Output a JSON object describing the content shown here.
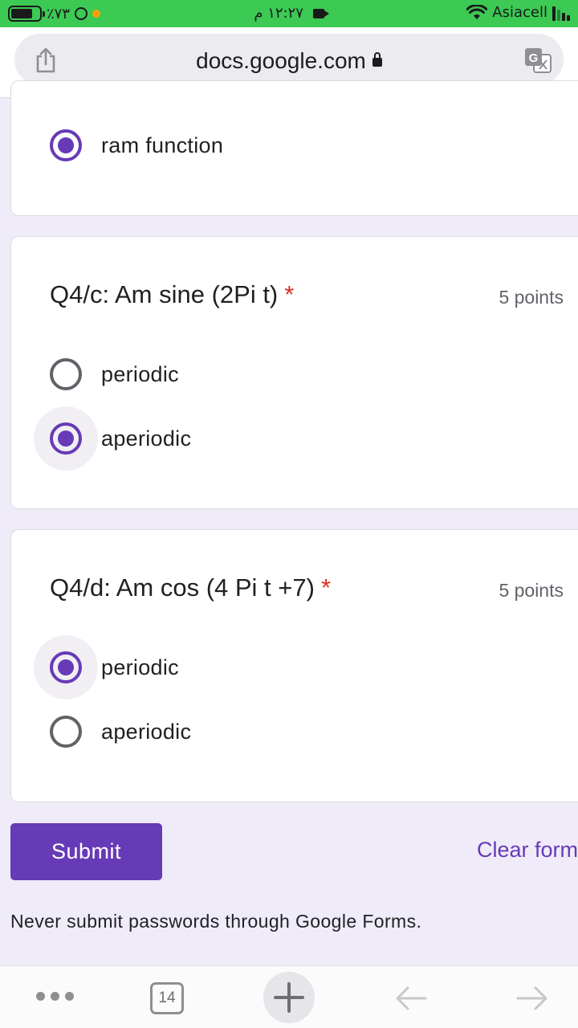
{
  "status_bar": {
    "battery": "٪٧٣",
    "time": "١٢:٢٧ م",
    "carrier": "Asiacell"
  },
  "browser": {
    "url": "docs.google.com",
    "share_icon": "share-icon",
    "translate_icon": "translate-icon"
  },
  "form": {
    "prev_question": {
      "option": {
        "label": "ram function",
        "selected": true
      }
    },
    "questions": [
      {
        "title": "Q4/c: Am sine (2Pi t)",
        "required_mark": "*",
        "points": "5 points",
        "options": [
          {
            "label": "periodic",
            "selected": false
          },
          {
            "label": "aperiodic",
            "selected": true
          }
        ]
      },
      {
        "title": "Q4/d: Am cos (4 Pi t +7)",
        "required_mark": "*",
        "points": "5 points",
        "options": [
          {
            "label": "periodic",
            "selected": true
          },
          {
            "label": "aperiodic",
            "selected": false
          }
        ]
      }
    ],
    "submit_label": "Submit",
    "clear_label": "Clear form",
    "note": "Never submit passwords through Google Forms.",
    "accent_color": "#673ab7",
    "required_color": "#d93025",
    "background_color": "#f0ebf8"
  },
  "toolbar": {
    "tab_count": "14",
    "more_icon": "more-icon",
    "new_tab_icon": "plus-icon",
    "back_icon": "back-arrow-icon",
    "forward_icon": "forward-arrow-icon"
  }
}
